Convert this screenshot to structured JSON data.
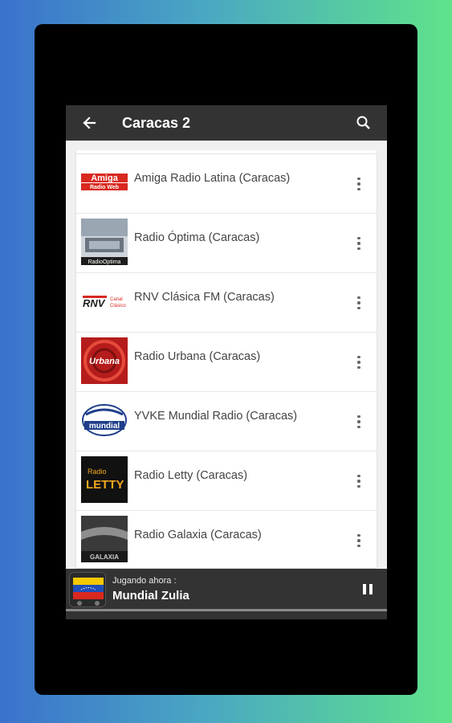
{
  "toolbar": {
    "title": "Caracas 2",
    "back_icon": "arrow-back-icon",
    "search_icon": "search-icon"
  },
  "stations": [
    {
      "name": "Amiga Radio Latina (Caracas)",
      "logo_text": "Amiga",
      "logo_subtext": "Radio Web"
    },
    {
      "name": "Radio Óptima (Caracas)",
      "logo_text": "RadioOptima"
    },
    {
      "name": "RNV Clásica FM (Caracas)",
      "logo_text": "RNV",
      "logo_subtext": "Canal Clásico"
    },
    {
      "name": "Radio Urbana (Caracas)",
      "logo_text": "Urbana"
    },
    {
      "name": "YVKE Mundial Radio (Caracas)",
      "logo_text": "mundial"
    },
    {
      "name": "Radio Letty (Caracas)",
      "logo_text": "Radio",
      "logo_subtext": "LETTY"
    },
    {
      "name": "Radio Galaxia (Caracas)",
      "logo_text": "GALAXIA"
    }
  ],
  "player": {
    "label": "Jugando ahora :",
    "title": "Mundial Zulia",
    "pause_icon": "pause-icon"
  },
  "colors": {
    "toolbar": "#333333",
    "list_bg": "#ffffff",
    "page_bg": "#f0f0f0"
  }
}
